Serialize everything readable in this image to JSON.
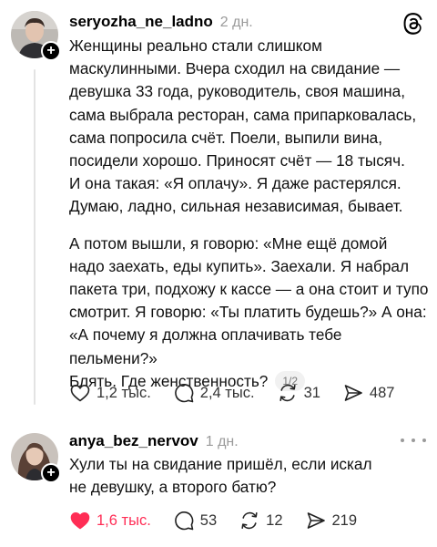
{
  "posts": [
    {
      "username": "seryozha_ne_ladno",
      "time": "2 дн.",
      "paragraph1": "Женщины реально стали слишком\nмаскулинными. Вчера сходил на свидание —\nдевушка 33 года, руководитель, своя машина,\nсама выбрала ресторан, сама припарковалась,\nсама попросила счёт. Поели, выпили вина,\nпосидели хорошо. Приносят счёт — 18 тысяч.\nИ она такая: «Я оплачу». Я даже растерялся.\nДумаю, ладно, сильная независимая, бывает.",
      "paragraph2": "А потом вышли, я говорю: «Мне ещё домой\nнадо заехать, еды купить». Заехали. Я набрал\nпакета три, подхожу к кассе — а она стоит и тупо\nсмотрит. Я говорю: «Ты платить будешь?» А она:\n«А почему я должна оплачивать тебе пельмени?»\nБлять. Где женственность?",
      "page_indicator": "1/2",
      "likes": "1,2 тыс.",
      "replies": "2,4 тыс.",
      "reposts": "31",
      "shares": "487",
      "liked": false
    },
    {
      "username": "anya_bez_nervov",
      "time": "1 дн.",
      "paragraph1": "Хули ты на свидание пришёл, если искал\nне девушку, а второго батю?",
      "likes": "1,6 тыс.",
      "replies": "53",
      "reposts": "12",
      "shares": "219",
      "liked": true
    }
  ],
  "icons": {
    "threads_logo": "threads-logo-icon",
    "more": "more-icon",
    "plus": "+"
  },
  "colors": {
    "liked": "#ff2d55",
    "muted": "#9a9a9a",
    "thread_line": "#e3e3e3"
  }
}
